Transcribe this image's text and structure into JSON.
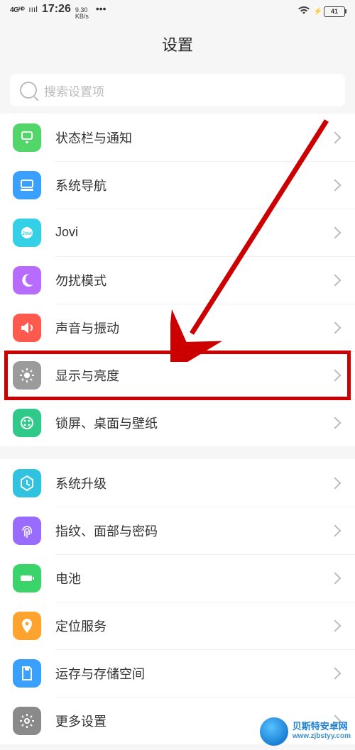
{
  "status": {
    "network_type": "4Gᴴᴰ",
    "signal": "ıııl",
    "time": "17:26",
    "data_rate_top": "9.30",
    "data_rate_bottom": "KB/s",
    "more": "•••",
    "battery_pct": "41"
  },
  "header": {
    "title": "设置"
  },
  "search": {
    "placeholder": "搜索设置项"
  },
  "groups": [
    {
      "rows": [
        {
          "id": "status-notif",
          "label": "状态栏与通知",
          "icon": "notification-icon",
          "color": "#52d66a"
        },
        {
          "id": "nav",
          "label": "系统导航",
          "icon": "navigation-icon",
          "color": "#3aa0ff"
        },
        {
          "id": "jovi",
          "label": "Jovi",
          "icon": "jovi-icon",
          "color": "#34d1e6"
        },
        {
          "id": "dnd",
          "label": "勿扰模式",
          "icon": "moon-icon",
          "color": "#b86bff"
        },
        {
          "id": "sound",
          "label": "声音与振动",
          "icon": "sound-icon",
          "color": "#ff5a4d"
        },
        {
          "id": "display",
          "label": "显示与亮度",
          "icon": "brightness-icon",
          "color": "#9b9b9b",
          "highlighted": true
        },
        {
          "id": "lock-wall",
          "label": "锁屏、桌面与壁纸",
          "icon": "wallpaper-icon",
          "color": "#2fc98a"
        }
      ]
    },
    {
      "rows": [
        {
          "id": "update",
          "label": "系统升级",
          "icon": "update-icon",
          "color": "#2fc3e0"
        },
        {
          "id": "biometric",
          "label": "指纹、面部与密码",
          "icon": "fingerprint-icon",
          "color": "#9a6bff"
        },
        {
          "id": "battery",
          "label": "电池",
          "icon": "battery-icon",
          "color": "#3bd46a"
        },
        {
          "id": "location",
          "label": "定位服务",
          "icon": "location-icon",
          "color": "#ffa32f"
        },
        {
          "id": "storage",
          "label": "运存与存储空间",
          "icon": "storage-icon",
          "color": "#3aa0ff"
        },
        {
          "id": "more",
          "label": "更多设置",
          "icon": "gear-icon",
          "color": "#8a8a8a"
        }
      ]
    }
  ],
  "watermark": {
    "line1": "贝斯特安卓网",
    "line2": "www.zjbstyy.com"
  }
}
